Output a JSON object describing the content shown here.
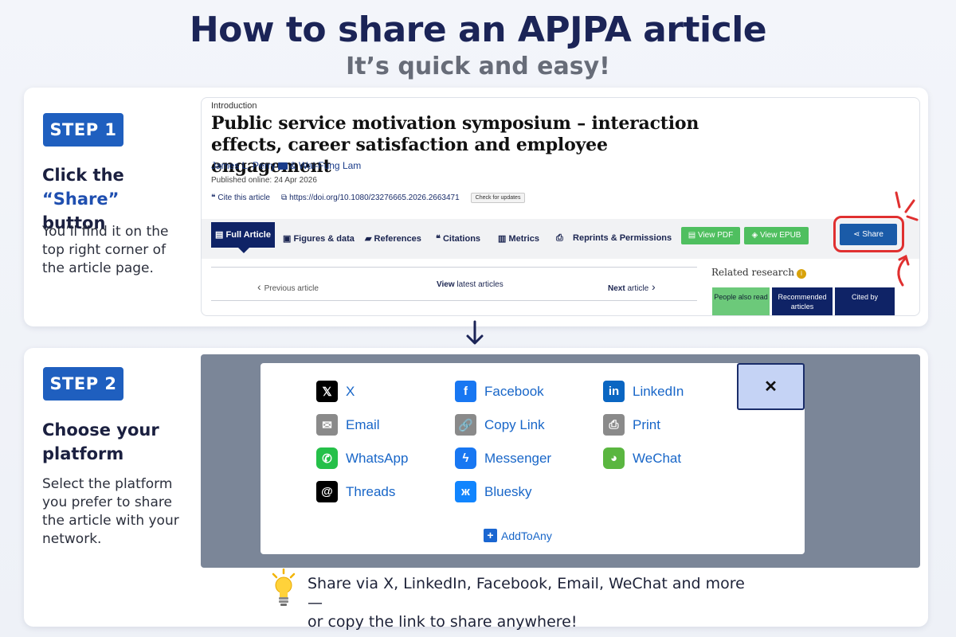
{
  "header": {
    "title": "How to share an APJPA article",
    "subtitle": "It’s quick and easy!"
  },
  "step1": {
    "badge": "STEP 1",
    "heading_part1": "Click the ",
    "heading_accent": "“Share”",
    "heading_part2": "button",
    "description": "You’ll find it on the top right corner of the article page.",
    "article": {
      "section": "Introduction",
      "title": "Public service motivation symposium – interaction effects, career satisfaction and employee engagement",
      "author1": "James L. Perry",
      "author2": "& Wai-Fung Lam",
      "published": "Published online: 24 Apr 2026",
      "cite": "Cite this article",
      "doi": "https://doi.org/10.1080/23276665.2026.2663471",
      "check_updates": "Check for updates",
      "tabs": {
        "full_article": "Full Article",
        "figures": "Figures & data",
        "references": "References",
        "citations": "Citations",
        "metrics": "Metrics",
        "reprints": "Reprints & Permissions"
      },
      "view_pdf": "View PDF",
      "view_epub": "View EPUB",
      "share": "Share",
      "prev_article": "Previous article",
      "view_latest_bold": "View",
      "view_latest_rest": " latest articles",
      "next_bold": "Next",
      "next_rest": " article",
      "related_title": "Related research",
      "related_tabs": {
        "people": "People also read",
        "recommended": "Recommended articles",
        "cited": "Cited by"
      }
    }
  },
  "step2": {
    "badge": "STEP 2",
    "heading": "Choose your platform",
    "description": "Select the platform you prefer to share the article with your network.",
    "close_symbol": "✕",
    "platforms": {
      "x": "X",
      "facebook": "Facebook",
      "linkedin": "LinkedIn",
      "email": "Email",
      "copy_link": "Copy Link",
      "print": "Print",
      "whatsapp": "WhatsApp",
      "messenger": "Messenger",
      "wechat": "WeChat",
      "threads": "Threads",
      "bluesky": "Bluesky"
    },
    "addtoany": "AddToAny"
  },
  "tip": {
    "line1": "Share via X, LinkedIn, Facebook, Email, WeChat and more—",
    "line2": "or copy the link to share anywhere!"
  },
  "colors": {
    "title": "#1b2457",
    "badge": "#1f5fbf",
    "accent": "#1f4fb0",
    "navy_tab": "#0f2366",
    "green": "#4fbf5f",
    "share_blue": "#1a5ba8",
    "red_circle": "#e03030",
    "link_blue": "#1866c8"
  }
}
